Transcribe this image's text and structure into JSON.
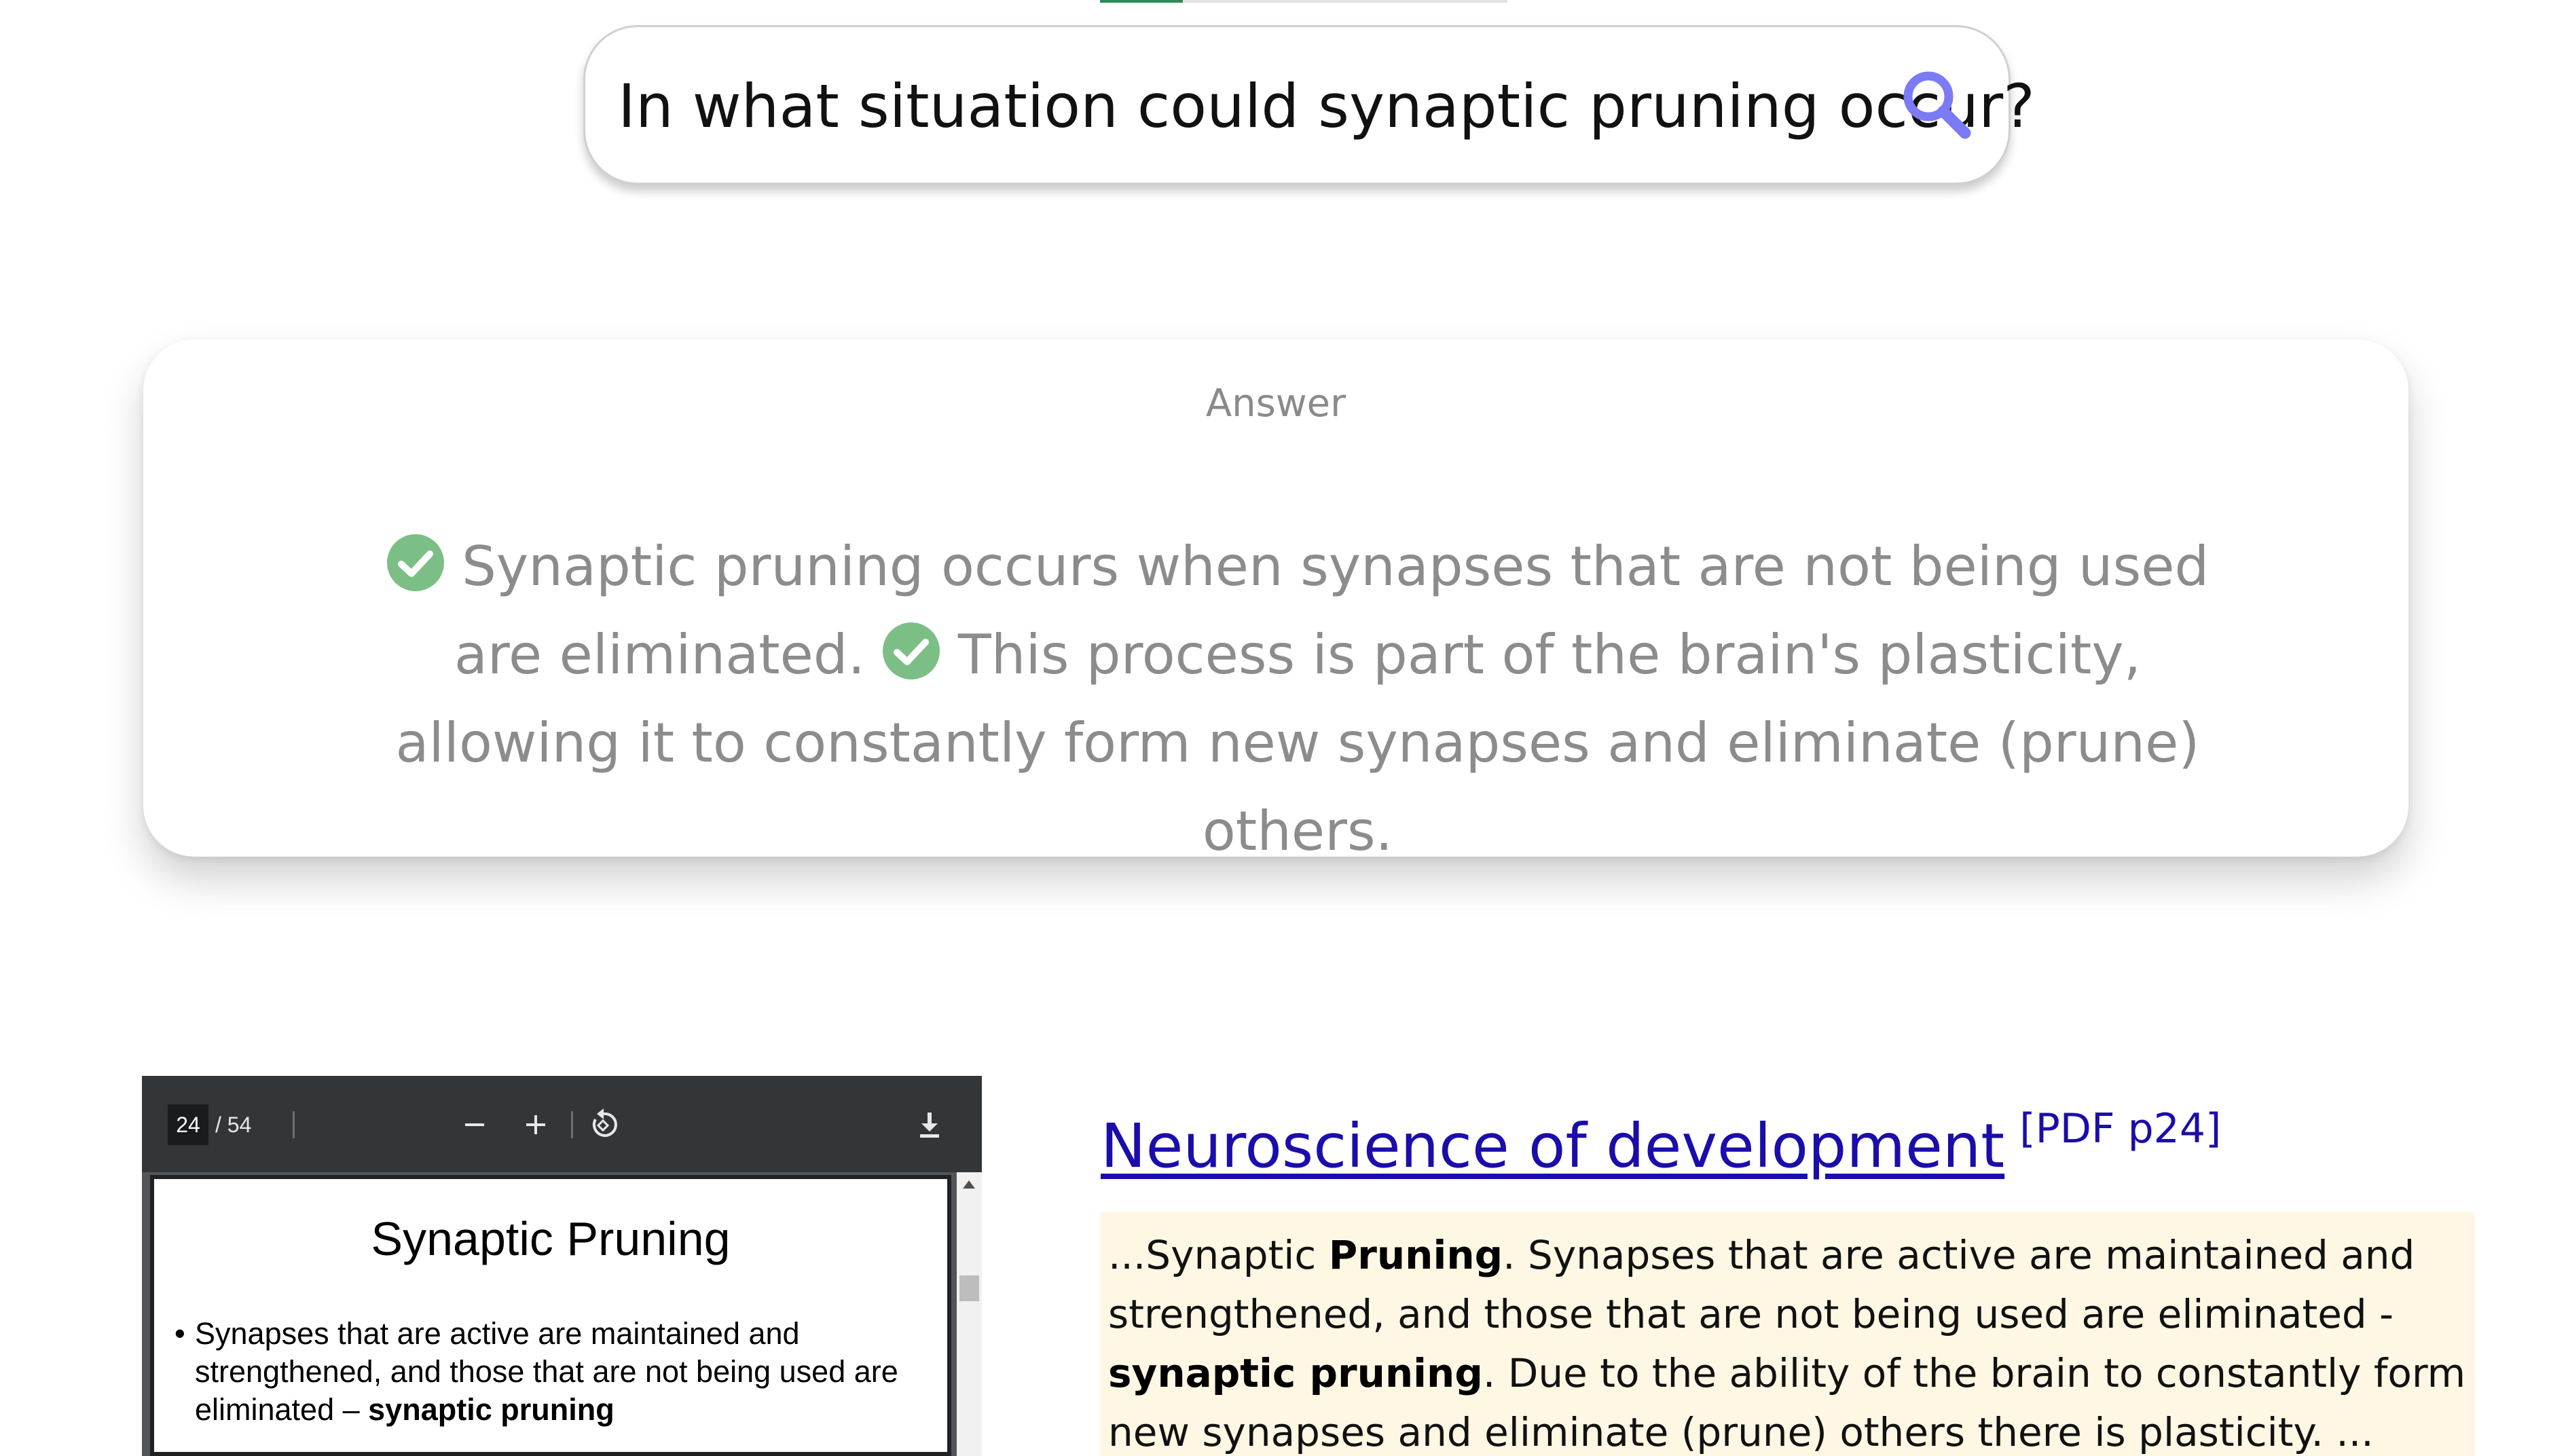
{
  "search": {
    "query": "In what situation could synaptic pruning occur?"
  },
  "answer": {
    "title": "Answer",
    "sentence_1": "Synaptic pruning occurs when synapses that are not being used are eliminated.",
    "sentence_2": "This process is part of the brain's plasticity, allowing it to constantly form new synapses and eliminate (prune) others."
  },
  "pdf_viewer": {
    "page_current": "24",
    "page_total": "/ 54",
    "slide_title": "Synaptic Pruning",
    "bullet_text": "Synapses that are active are maintained and strengthened, and those that are not being used are eliminated – ",
    "bullet_bold": "synaptic pruning"
  },
  "result": {
    "title": "Neuroscience of development",
    "source_tag": "[PDF p24]",
    "snippet": {
      "part_1": "...Synaptic ",
      "bold_1": "Pruning",
      "part_2": ". Synapses that are active are maintained and strengthened, and those that are not being used are eliminated - ",
      "bold_2": "synaptic pruning",
      "part_3": ". Due to the ability of the brain to constantly form new synapses and eliminate (prune) others there is plasticity.  ..."
    }
  },
  "colors": {
    "link": "#1a0dab",
    "check_green": "#7cbf86",
    "search_icon": "#7b7bf5",
    "snippet_bg": "#fdf7e3"
  }
}
